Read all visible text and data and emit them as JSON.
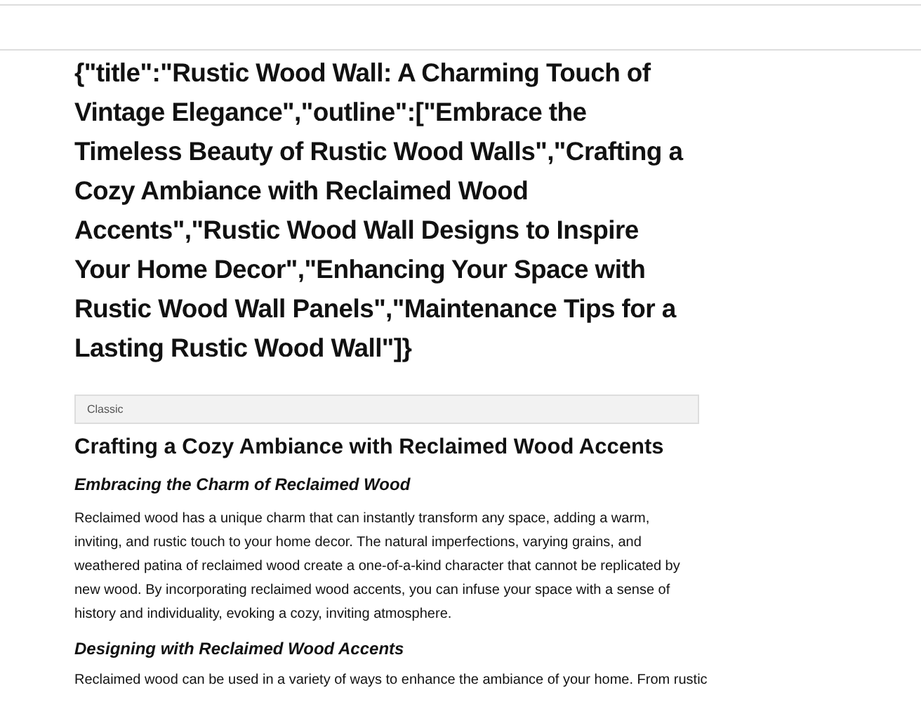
{
  "article": {
    "heading": "{\"title\":\"Rustic Wood Wall: A Charming Touch of Vintage Elegance\",\"outline\":[\"Embrace the Timeless Beauty of Rustic Wood Walls\",\"Crafting a Cozy Ambiance with Reclaimed Wood Accents\",\"Rustic Wood Wall Designs to Inspire Your Home Decor\",\"Enhancing Your Space with Rustic Wood Wall Panels\",\"Maintenance Tips for a Lasting Rustic Wood Wall\"]}",
    "style_label": "Classic",
    "section_title": "Crafting a Cozy Ambiance with Reclaimed Wood Accents",
    "blocks": [
      {
        "kind": "subheading",
        "text": "Embracing the Charm of Reclaimed Wood"
      },
      {
        "kind": "paragraph",
        "text": "Reclaimed wood has a unique charm that can instantly transform any space, adding a warm, inviting, and rustic touch to your home decor. The natural imperfections, varying grains, and weathered patina of reclaimed wood create a one-of-a-kind character that cannot be replicated by new wood. By incorporating reclaimed wood accents, you can infuse your space with a sense of history and individuality, evoking a cozy, inviting atmosphere."
      },
      {
        "kind": "subheading",
        "text": "Designing with Reclaimed Wood Accents"
      },
      {
        "kind": "paragraph_cut",
        "text": "Reclaimed wood can be used in a variety of ways to enhance the ambiance of your home. From rustic"
      }
    ]
  }
}
